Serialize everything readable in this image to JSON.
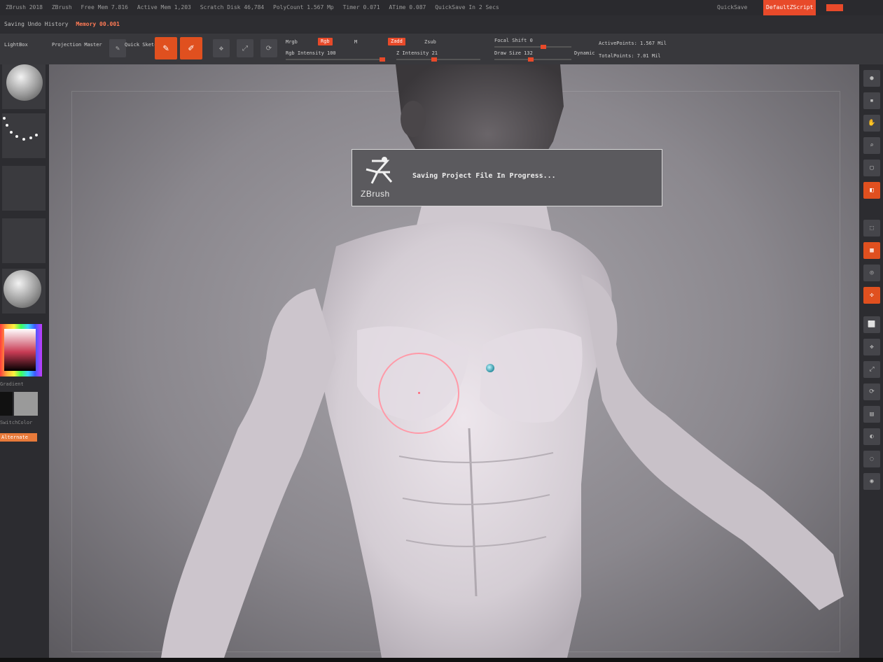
{
  "menubar": {
    "items": [
      "ZBrush 2018",
      "ZBrush",
      "Free Mem 7.816",
      "Active Mem 1,203",
      "Scratch Disk 46,784",
      "PolyCount 1.567 Mp",
      "Timer 0.071",
      "ATime 0.087",
      "QuickSave In 2 Secs"
    ],
    "right_label": "QuickSave",
    "right_accent": "DefaultZScript"
  },
  "subbar": {
    "left_label": "Saving Undo History",
    "mem_label": "Memory 00.001"
  },
  "toolbar": {
    "lightbox": "LightBox",
    "projection": "Projection Master",
    "quick_sketch": "Quick Sketch",
    "edit_label": "Edit",
    "draw_label": "Draw",
    "move_label": "Move",
    "scale_label": "Scale",
    "rotate_label": "Rotate",
    "rgb_label": "Mrgb",
    "rgb_chip": "Rgb",
    "m_label": "M",
    "zadd_chip": "Zadd",
    "zsub_label": "Zsub",
    "rgb_intensity": "Rgb Intensity 100",
    "z_intensity": "Z Intensity 21",
    "focal_shift": "Focal Shift 0",
    "draw_size": "Draw Size 132",
    "dynamic": "Dynamic",
    "active_points": "ActivePoints: 1.567 Mil",
    "total_points": "TotalPoints: 7.01 Mil"
  },
  "lefttray": {
    "gradient_label": "Gradient",
    "switch_label": "SwitchColor",
    "alternate_label": "Alternate"
  },
  "dialog": {
    "message": "Saving Project File In Progress...",
    "logo_text": "ZBrush"
  },
  "righttray": {
    "buttons": [
      "BPR",
      "SPix",
      "Scroll",
      "Zoom",
      "Actual",
      "AAHalf",
      "Persp",
      "Floor",
      "Local",
      "LSym",
      "Gxyz",
      "Frame",
      "Move",
      "Scale",
      "Rotate",
      "Line Fill",
      "PolyF",
      "Transp"
    ]
  },
  "colors": {
    "accent": "#e84a2a",
    "ui_dark": "#2c2c30",
    "canvas": "#9a979c"
  }
}
